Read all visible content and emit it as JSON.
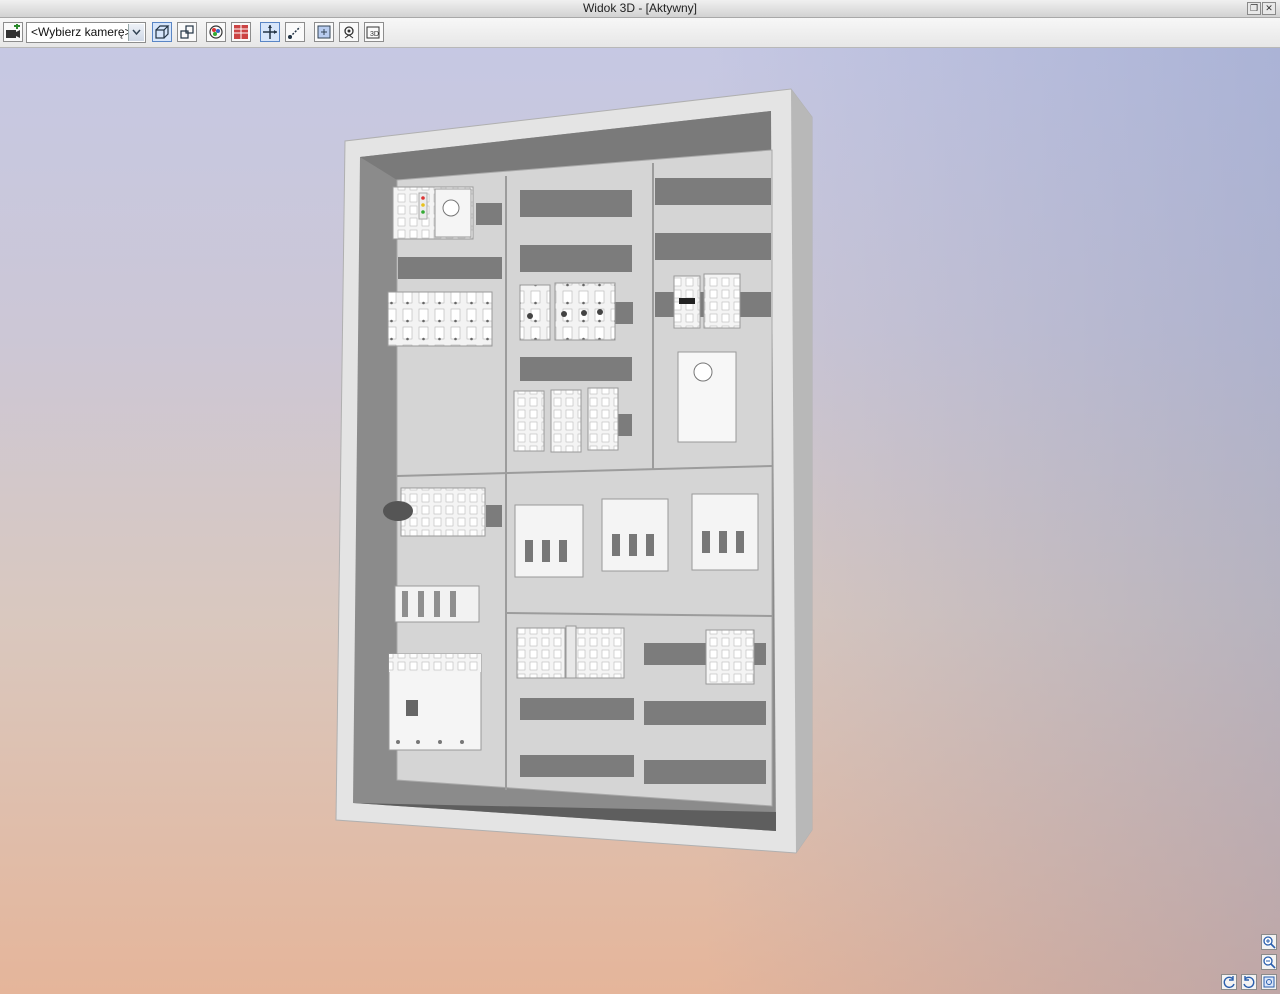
{
  "window": {
    "title": "Widok 3D - [Aktywny]"
  },
  "toolbar": {
    "camera_select": {
      "value": "<Wybierz kamerę>"
    },
    "buttons": [
      {
        "icon": "add-camera-icon"
      },
      {
        "icon": "perspective-view-icon",
        "active": true
      },
      {
        "icon": "orthographic-view-icon"
      },
      {
        "icon": "render-mode-icon"
      },
      {
        "icon": "cabinet-view-icon"
      },
      {
        "icon": "move-axis-icon",
        "active": true
      },
      {
        "icon": "rotate-axis-icon"
      },
      {
        "icon": "fit-view-icon"
      },
      {
        "icon": "camera-settings-icon"
      },
      {
        "icon": "3d-mode-icon"
      }
    ]
  },
  "nav_controls": [
    {
      "icon": "zoom-in-icon"
    },
    {
      "icon": "zoom-out-icon"
    },
    {
      "icon": "rotate-left-icon"
    },
    {
      "icon": "rotate-right-icon"
    },
    {
      "icon": "zoom-extents-icon"
    }
  ],
  "colors": {
    "accent": "#5a86c5",
    "cabinet": "#d8d8d8",
    "rail": "#7c7c7c"
  }
}
